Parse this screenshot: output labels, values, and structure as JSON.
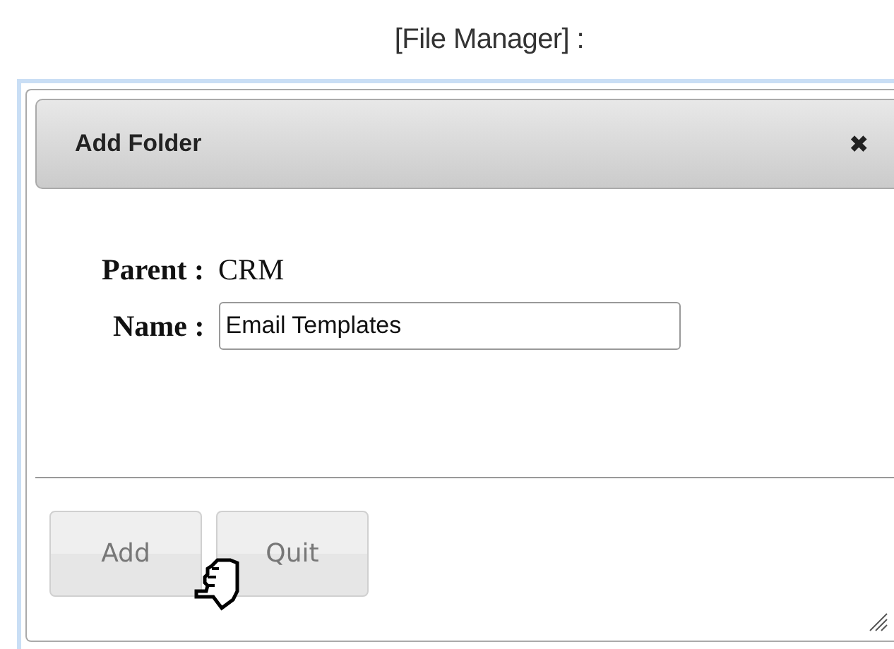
{
  "caption": "[File Manager] :",
  "dialog": {
    "title": "Add Folder",
    "close": "✖",
    "fields": [
      {
        "kind": "text",
        "label": "Parent :",
        "value": "CRM"
      },
      {
        "kind": "input",
        "label": "Name :",
        "value": "Email Templates"
      }
    ],
    "buttons": [
      "Add",
      "Quit"
    ]
  }
}
